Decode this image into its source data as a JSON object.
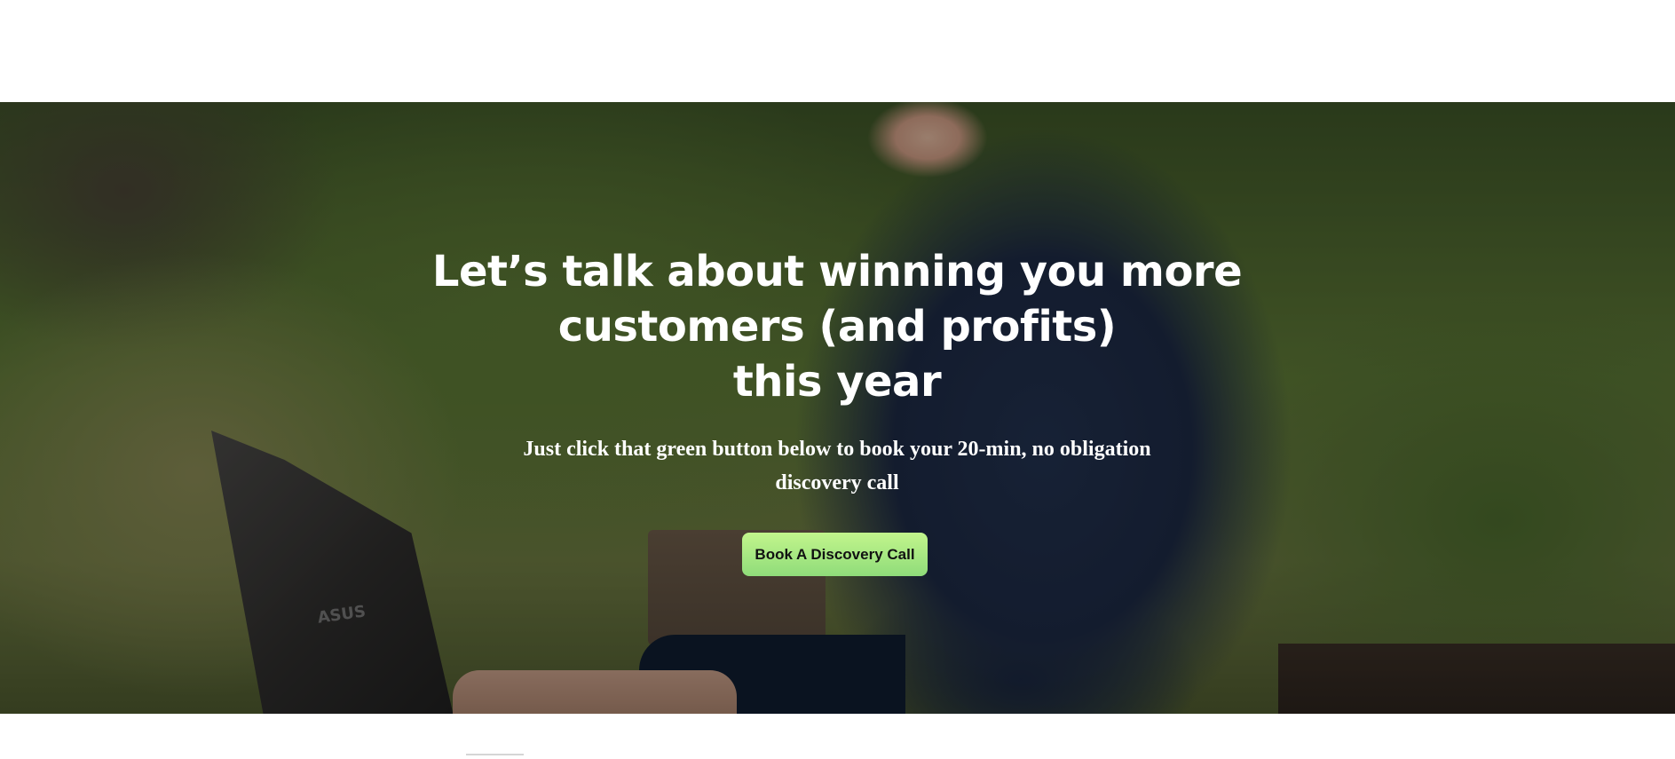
{
  "hero": {
    "headline_line1": "Let’s talk about winning you more",
    "headline_line2": "customers (and profits)",
    "headline_line3": "this year",
    "subheadline": "Just click that green button below to book your 20-min, no obligation discovery call",
    "cta_label": "Book A Discovery Call",
    "laptop_logo": "ASUS"
  },
  "colors": {
    "cta_top": "#c2f58c",
    "cta_bottom": "#8fdc7a",
    "headline": "#ffffff"
  }
}
